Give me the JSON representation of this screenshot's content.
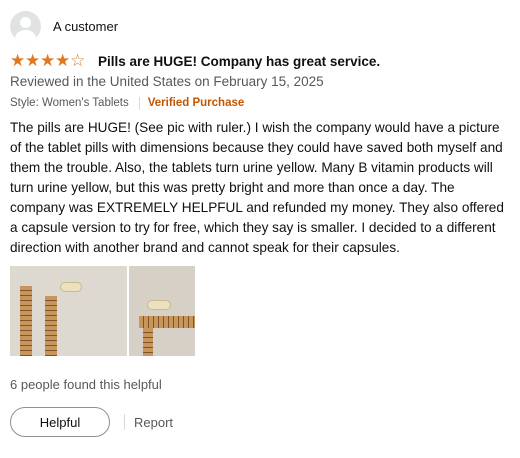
{
  "review": {
    "author": "A customer",
    "rating": 4,
    "rating_max": 5,
    "star_color": "#de7921",
    "title": "Pills are HUGE! Company has great service.",
    "reviewed_on": "Reviewed in the United States on February 15, 2025",
    "style": "Style: Women's Tablets",
    "verified": "Verified Purchase",
    "verified_color": "#c45500",
    "body": "The pills are HUGE! (See pic with ruler.) I wish the company would have a picture of the tablet pills with dimensions because they could have saved both myself and them the trouble. Also, the tablets turn urine yellow. Many B vitamin products will turn urine yellow, but this was pretty bright and more than once a day. The company was EXTREMELY HELPFUL and refunded my money. They also offered a capsule version to try for free, which they say is smaller. I decided to a different direction with another brand and cannot speak for their capsules.",
    "images": [
      "photo-pill-with-ruler-vertical",
      "photo-pill-with-ruler-horizontal"
    ],
    "helpful_count": "6 people found this helpful",
    "helpful_button": "Helpful",
    "report_link": "Report"
  }
}
